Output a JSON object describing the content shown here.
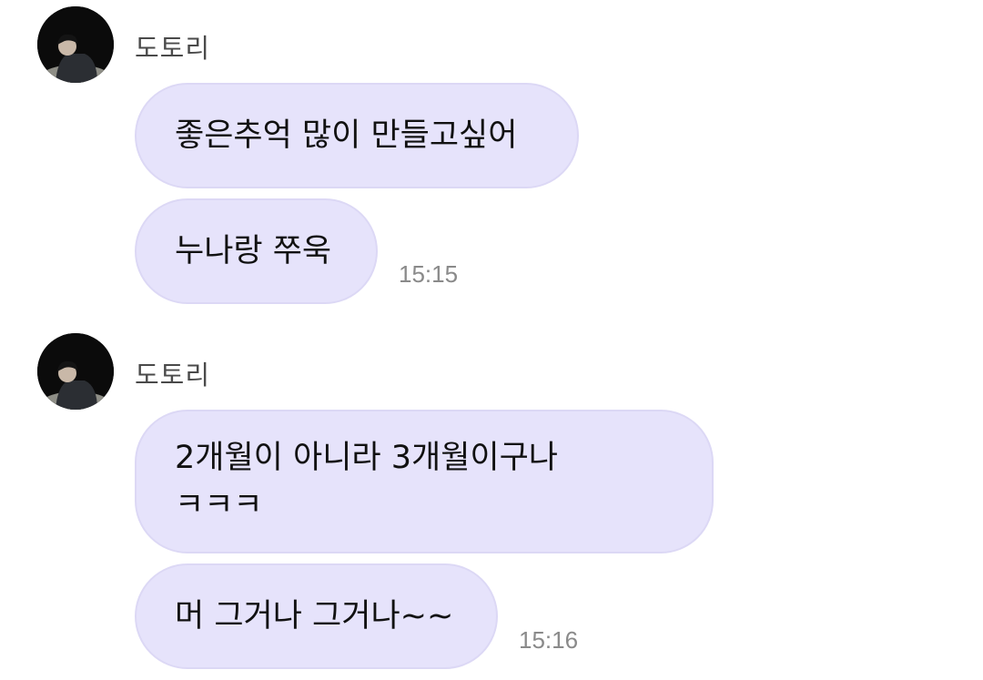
{
  "colors": {
    "bubble_bg": "#e6e3fb",
    "bubble_border": "#dcd8f5",
    "sender_text": "#4a4a4a",
    "time_text": "#8a8a8a"
  },
  "groups": [
    {
      "sender": "도토리",
      "avatar_icon": "profile-photo-avatar",
      "messages": [
        {
          "lines": [
            "좋은추억 많이 만들고싶어"
          ]
        },
        {
          "lines": [
            "누나랑 쭈욱"
          ]
        }
      ],
      "time": "15:15"
    },
    {
      "sender": "도토리",
      "avatar_icon": "profile-photo-avatar",
      "messages": [
        {
          "lines": [
            "2개월이 아니라 3개월이구나",
            "ㅋㅋㅋ"
          ]
        },
        {
          "lines": [
            "머 그거나 그거나~~"
          ]
        }
      ],
      "time": "15:16"
    }
  ]
}
